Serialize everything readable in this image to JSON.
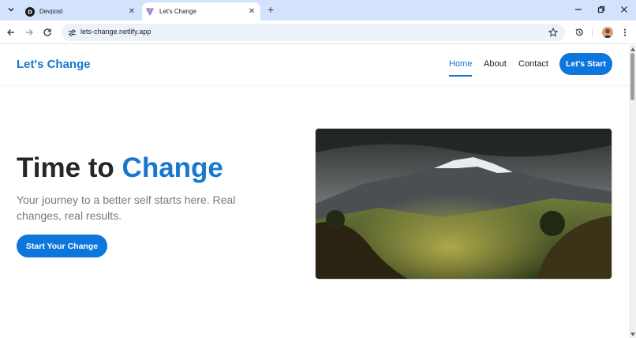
{
  "browser": {
    "tabs": [
      {
        "title": "Devpost",
        "favicon": "devpost-logo-icon",
        "active": false
      },
      {
        "title": "Let's Change",
        "favicon": "vite-logo-icon",
        "active": true
      }
    ],
    "url": "lets-change.netlify.app"
  },
  "site": {
    "brand": "Let's Change",
    "nav": {
      "home": "Home",
      "about": "About",
      "contact": "Contact",
      "cta": "Let's Start"
    },
    "hero": {
      "title_prefix": "Time to ",
      "title_accent": "Change",
      "subtitle": "Your journey to a better self starts here. Real changes, real results.",
      "button": "Start Your Change",
      "image": "mountain-landscape-image"
    }
  },
  "colors": {
    "accent": "#1877d1",
    "button": "#0d76dc",
    "tabstrip": "#d3e3fd"
  }
}
